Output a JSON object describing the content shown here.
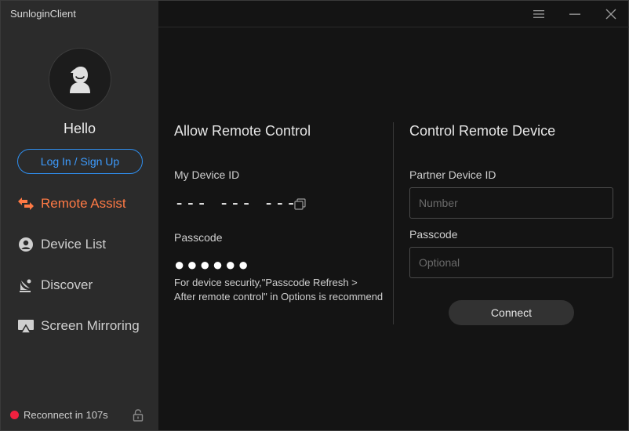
{
  "app": {
    "title": "SunloginClient"
  },
  "colors": {
    "accent_blue": "#2f8ff0",
    "accent_orange": "#ff7a45",
    "status_red": "#f0213f",
    "sidebar_bg": "#2b2b2b",
    "main_bg": "#141414"
  },
  "titlebar": {
    "icons": [
      "menu-icon",
      "minimize-icon",
      "close-icon"
    ]
  },
  "user": {
    "greeting": "Hello",
    "login_label": "Log In / Sign Up"
  },
  "sidebar": {
    "items": [
      {
        "label": "Remote Assist",
        "icon": "remote-assist-icon",
        "active": true
      },
      {
        "label": "Device List",
        "icon": "device-list-icon",
        "active": false
      },
      {
        "label": "Discover",
        "icon": "discover-icon",
        "active": false
      },
      {
        "label": "Screen Mirroring",
        "icon": "screen-mirroring-icon",
        "active": false
      }
    ]
  },
  "status": {
    "text": "Reconnect in 107s"
  },
  "allow": {
    "title": "Allow Remote Control",
    "device_id_label": "My Device ID",
    "device_id_value": "--- --- ---",
    "passcode_label": "Passcode",
    "passcode_value": "●●●●●●",
    "note_line1": "For device security,\"Passcode Refresh >",
    "note_line2": "After remote control\" in Options is recommend"
  },
  "control": {
    "title": "Control Remote Device",
    "partner_label": "Partner Device ID",
    "partner_placeholder": "Number",
    "passcode_label": "Passcode",
    "passcode_placeholder": "Optional",
    "connect_label": "Connect"
  }
}
